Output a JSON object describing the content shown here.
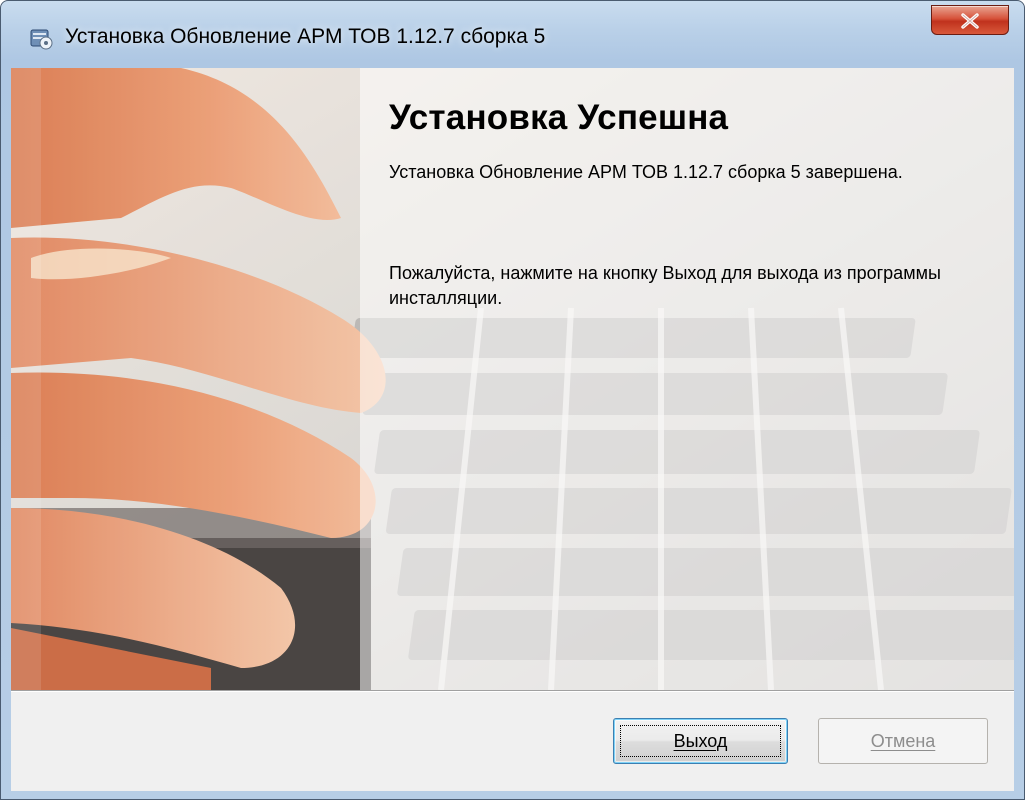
{
  "window": {
    "title": "Установка Обновление АРМ ТОВ 1.12.7 сборка 5",
    "close_icon": "close-icon",
    "app_icon": "installer-icon"
  },
  "main": {
    "heading": "Установка Успешна",
    "description": "Установка Обновление АРМ ТОВ 1.12.7 сборка 5 завершена.",
    "instruction": "Пожалуйста, нажмите на кнопку Выход для выхода из программы инсталляции."
  },
  "footer": {
    "exit_label": "Выход",
    "cancel_label": "Отмена"
  },
  "colors": {
    "close_button": "#c73a22",
    "focus_border": "#3c7fb1",
    "disabled_text": "#8d8d8d"
  }
}
